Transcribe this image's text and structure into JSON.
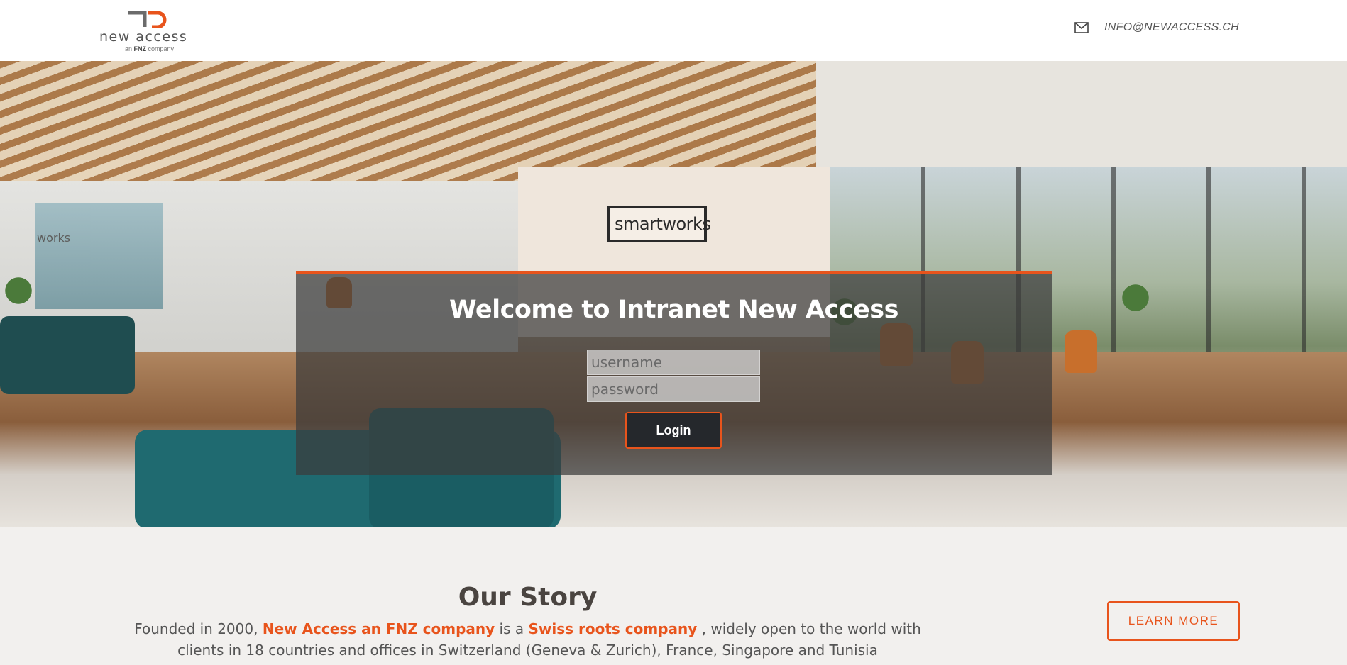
{
  "header": {
    "logo_text": "new access",
    "logo_sub_prefix": "an ",
    "logo_sub_brand": "FNZ",
    "logo_sub_suffix": " company",
    "email_icon": "mail-icon",
    "email": "INFO@NEWACCESS.CH"
  },
  "hero": {
    "sign_text": "smartworks",
    "photo_wall_text": "works"
  },
  "login": {
    "title": "Welcome to Intranet New Access",
    "username_placeholder": "username",
    "password_placeholder": "password",
    "login_label": "Login"
  },
  "story": {
    "title": "Our Story",
    "text_1": "Founded in 2000, ",
    "highlight_1": "New Access an FNZ company",
    "text_2": " is a ",
    "highlight_2": "Swiss roots company",
    "text_3": " , widely open to the world with clients in 18 countries and offices in Switzerland (Geneva & Zurich), France, Singapore and Tunisia",
    "learn_more_label": "LEARN MORE"
  },
  "colors": {
    "accent": "#e8541c",
    "card_bg": "rgba(60,60,60,0.72)",
    "button_dark": "#25282c",
    "section_bg": "#f2f0ee"
  }
}
